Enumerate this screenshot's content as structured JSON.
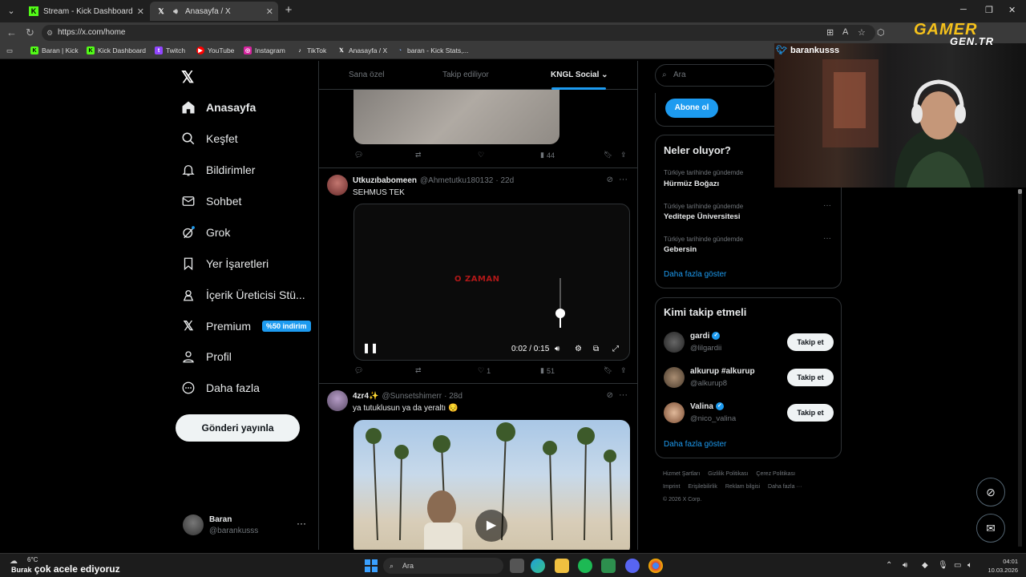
{
  "browser": {
    "tabs": [
      {
        "label": "Stream - Kick Dashboard",
        "icon": "kick-icon"
      },
      {
        "label": "Anasayfa / X",
        "icon": "x-logo-icon"
      }
    ],
    "url": "https://x.com/home",
    "bookmarks": [
      {
        "label": "Baran | Kick",
        "icon": "kick-icon"
      },
      {
        "label": "Kick Dashboard",
        "icon": "kick-icon"
      },
      {
        "label": "Twitch",
        "icon": "twitch-icon"
      },
      {
        "label": "YouTube",
        "icon": "youtube-icon"
      },
      {
        "label": "Instagram",
        "icon": "instagram-icon"
      },
      {
        "label": "TikTok",
        "icon": "tiktok-icon"
      },
      {
        "label": "Anasayfa / X",
        "icon": "x-logo-icon"
      },
      {
        "label": "baran - Kick Stats,...",
        "icon": "stats-icon"
      }
    ]
  },
  "nav": {
    "items": [
      {
        "label": "Anasayfa",
        "icon": "home-icon"
      },
      {
        "label": "Keşfet",
        "icon": "search-icon"
      },
      {
        "label": "Bildirimler",
        "icon": "bell-icon"
      },
      {
        "label": "Sohbet",
        "icon": "mail-icon"
      },
      {
        "label": "Grok",
        "icon": "grok-icon"
      },
      {
        "label": "Yer İşaretleri",
        "icon": "bookmark-icon"
      },
      {
        "label": "İçerik Üreticisi Stü...",
        "icon": "creator-icon"
      },
      {
        "label": "Premium",
        "icon": "x-logo-icon"
      },
      {
        "label": "Profil",
        "icon": "person-icon"
      },
      {
        "label": "Daha fazla",
        "icon": "more-circle-icon"
      }
    ],
    "premium_badge": "%50 indirim",
    "post_button": "Gönderi yayınla",
    "account": {
      "name": "Baran",
      "handle": "@barankusss"
    }
  },
  "timeline": {
    "tabs": [
      "Sana özel",
      "Takip ediliyor",
      "KNGL Social"
    ],
    "post0": {
      "views": "44"
    },
    "post1": {
      "name": "Utkuzıbabomeen",
      "handle": "@Ahmetutku180132",
      "time": "· 22d",
      "text": "SEHMUS TEK",
      "video_overlay": "O ZAMAN",
      "video_time": "0:02 / 0:15",
      "likes": "1",
      "views": "51"
    },
    "post2": {
      "name": "4zr4✨",
      "handle": "@Sunsetshimerr",
      "time": "· 28d",
      "text": "ya tutuklusun ya da yeraltı 😔"
    }
  },
  "sidebar": {
    "search_placeholder": "Ara",
    "subscribe": "Abone ol",
    "trends_title": "Neler oluyor?",
    "trends": [
      {
        "context": "Türkiye tarihinde gündemde",
        "name": "Hürmüz Boğazı"
      },
      {
        "context": "Türkiye tarihinde gündemde",
        "name": "Yeditepe Üniversitesi"
      },
      {
        "context": "Türkiye tarihinde gündemde",
        "name": "Gebersin"
      }
    ],
    "show_more": "Daha fazla göster",
    "who_title": "Kimi takip etmeli",
    "who": [
      {
        "name": "gardi",
        "handle": "@lilgardii",
        "verified": true
      },
      {
        "name": "alkurup #alkurup",
        "handle": "@alkurup8",
        "verified": false
      },
      {
        "name": "Valina",
        "handle": "@nico_valina",
        "verified": true
      }
    ],
    "follow_label": "Takip et",
    "footer": [
      "Hizmet Şartları",
      "Gizlilik Politikası",
      "Çerez Politikası",
      "Imprint",
      "Erişilebilirlik",
      "Reklam bilgisi",
      "Daha fazla ···",
      "© 2026 X Corp."
    ]
  },
  "overlay": {
    "webcam_name": "barankusss",
    "logo_top": "GAMER",
    "logo_bottom": "GEN.TR"
  },
  "taskbar": {
    "temp": "6°C",
    "ticker": "çok acele ediyoruz",
    "ticker_prefix": "Burak",
    "search": "Ara",
    "time": "04:01",
    "date": "10.03.2026"
  },
  "colors": {
    "accent": "#1d9bf0",
    "background": "#000000",
    "gamer_yellow": "#f6c21b"
  }
}
